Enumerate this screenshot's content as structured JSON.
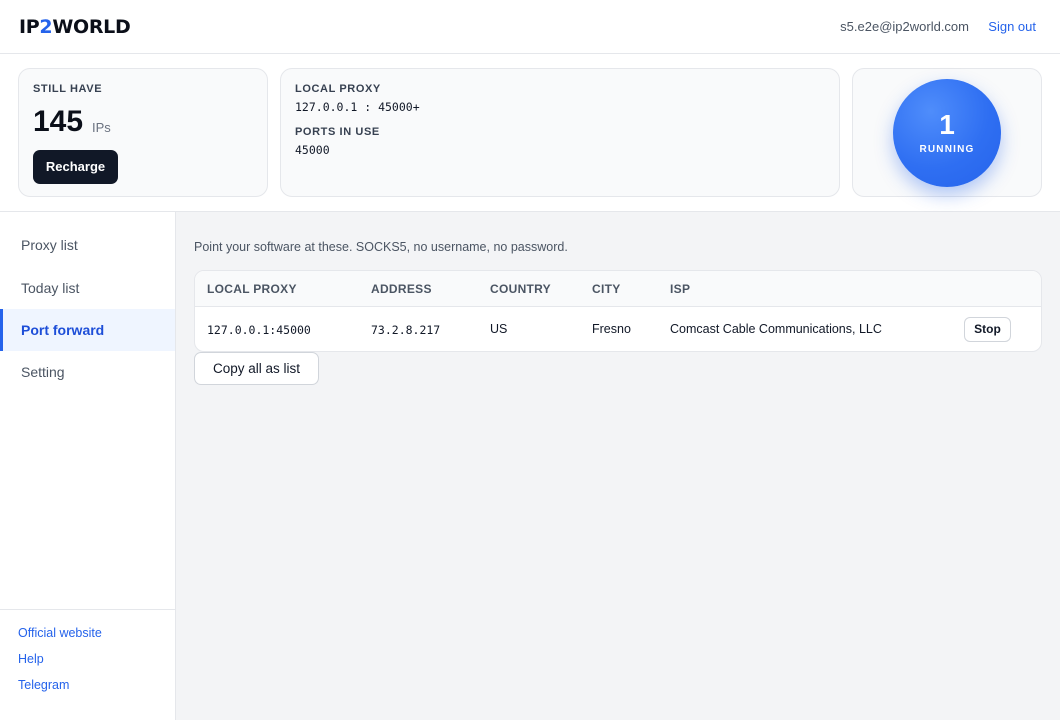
{
  "header": {
    "logo_prefix": "IP",
    "logo_accent": "2",
    "logo_suffix": "WORLD",
    "user_email": "s5.e2e@ip2world.com",
    "sign_out_label": "Sign out"
  },
  "stats": {
    "ips": {
      "label": "STILL HAVE",
      "count": "145",
      "unit": "IPs",
      "recharge_label": "Recharge"
    },
    "proxy": {
      "local_proxy_label": "LOCAL PROXY",
      "local_proxy_value": "127.0.0.1 : 45000+",
      "ports_label": "PORTS IN USE",
      "ports_value": "45000"
    },
    "running": {
      "count": "1",
      "label": "RUNNING"
    }
  },
  "sidebar": {
    "items": [
      {
        "label": "Proxy list",
        "active": false
      },
      {
        "label": "Today list",
        "active": false
      },
      {
        "label": "Port forward",
        "active": true
      },
      {
        "label": "Setting",
        "active": false
      }
    ],
    "footer_links": [
      "Official website",
      "Help",
      "Telegram"
    ]
  },
  "main": {
    "hint": "Point your software at these. SOCKS5, no username, no password.",
    "table": {
      "headers": [
        "LOCAL PROXY",
        "ADDRESS",
        "COUNTRY",
        "CITY",
        "ISP"
      ],
      "rows": [
        {
          "local_proxy": "127.0.0.1:45000",
          "address": "73.2.8.217",
          "country": "US",
          "city": "Fresno",
          "isp": "Comcast Cable Communications, LLC",
          "action_label": "Stop"
        }
      ]
    },
    "copy_label": "Copy all as list"
  },
  "colors": {
    "accent": "#2563eb",
    "dark_button": "#111827",
    "active_nav_bg": "#eff5ff"
  }
}
